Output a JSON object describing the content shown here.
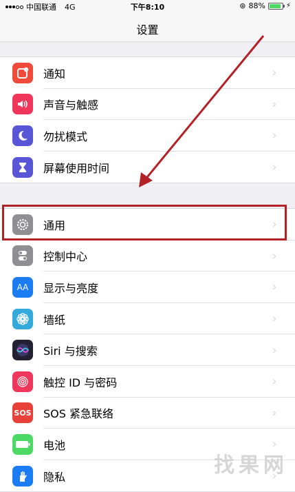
{
  "status": {
    "carrier": "中国联通",
    "network": "4G",
    "time": "下午8:10",
    "battery": "88%",
    "battery_level": 0.88
  },
  "nav": {
    "title": "设置"
  },
  "groups": [
    {
      "items": [
        {
          "label": "通知",
          "icon": "notifications-icon",
          "color": "#f04a3a"
        },
        {
          "label": "声音与触感",
          "icon": "speaker-icon",
          "color": "#f0365a"
        },
        {
          "label": "勿扰模式",
          "icon": "moon-icon",
          "color": "#5856d6"
        },
        {
          "label": "屏幕使用时间",
          "icon": "hourglass-icon",
          "color": "#5856d6"
        }
      ]
    },
    {
      "items": [
        {
          "label": "通用",
          "icon": "gear-icon",
          "color": "#8e8e93"
        },
        {
          "label": "控制中心",
          "icon": "toggles-icon",
          "color": "#8e8e93"
        },
        {
          "label": "显示与亮度",
          "icon": "text-size-icon",
          "color": "#1b7cf4"
        },
        {
          "label": "墙纸",
          "icon": "flower-icon",
          "color": "#34aadc"
        },
        {
          "label": "Siri 与搜索",
          "icon": "siri-icon",
          "color": "#222233"
        },
        {
          "label": "触控 ID 与密码",
          "icon": "fingerprint-icon",
          "color": "#f0365a"
        },
        {
          "label": "SOS 紧急联络",
          "icon": "sos-icon",
          "color": "#e8413a"
        },
        {
          "label": "电池",
          "icon": "battery-icon",
          "color": "#4cd964"
        },
        {
          "label": "隐私",
          "icon": "hand-icon",
          "color": "#1b7cf4"
        }
      ]
    }
  ],
  "chevron": "›",
  "icon_text": {
    "aa": "AA",
    "sos": "SOS"
  },
  "watermark": "找果网",
  "annotation": {
    "highlight_color": "#b32025"
  }
}
